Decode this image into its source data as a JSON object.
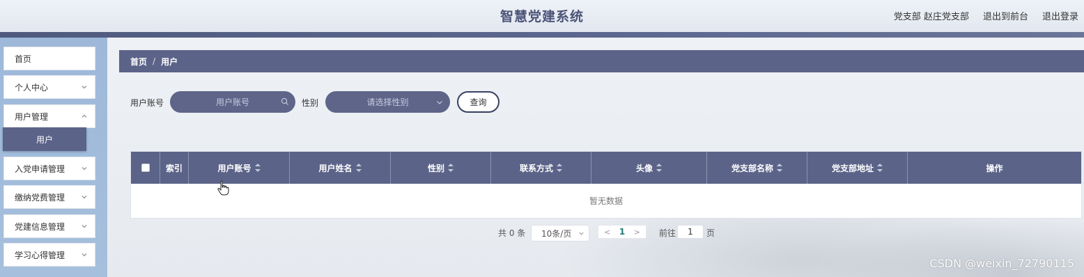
{
  "header": {
    "title": "智慧党建系统",
    "user_label": "党支部 赵庄党支部",
    "front_label": "退出到前台",
    "logout_label": "退出登录"
  },
  "sidebar": {
    "items": [
      {
        "label": "首页",
        "has_submenu": false
      },
      {
        "label": "个人中心",
        "has_submenu": true
      },
      {
        "label": "用户管理",
        "has_submenu": true,
        "expanded": true
      },
      {
        "label": "入党申请管理",
        "has_submenu": true
      },
      {
        "label": "缴纳党费管理",
        "has_submenu": true
      },
      {
        "label": "党建信息管理",
        "has_submenu": true
      },
      {
        "label": "学习心得管理",
        "has_submenu": true
      }
    ],
    "active_sub": "用户"
  },
  "breadcrumb": {
    "home": "首页",
    "sep": "/",
    "current": "用户"
  },
  "search": {
    "account_label": "用户账号",
    "account_placeholder": "用户账号",
    "gender_label": "性别",
    "gender_placeholder": "请选择性别",
    "query_label": "查询"
  },
  "table": {
    "columns": [
      "索引",
      "用户账号",
      "用户姓名",
      "性别",
      "联系方式",
      "头像",
      "党支部名称",
      "党支部地址",
      "操作"
    ],
    "empty_text": "暂无数据"
  },
  "pagination": {
    "total": "共 0 条",
    "page_size": "10条/页",
    "current_page": "1",
    "goto_label": "前往",
    "goto_value": "1",
    "page_suffix": "页"
  },
  "watermark": "CSDN @weixin_72790115",
  "colors": {
    "primary": "#5b6388",
    "sidebar": "#9db8d9",
    "pager_active": "#1f7a77"
  }
}
